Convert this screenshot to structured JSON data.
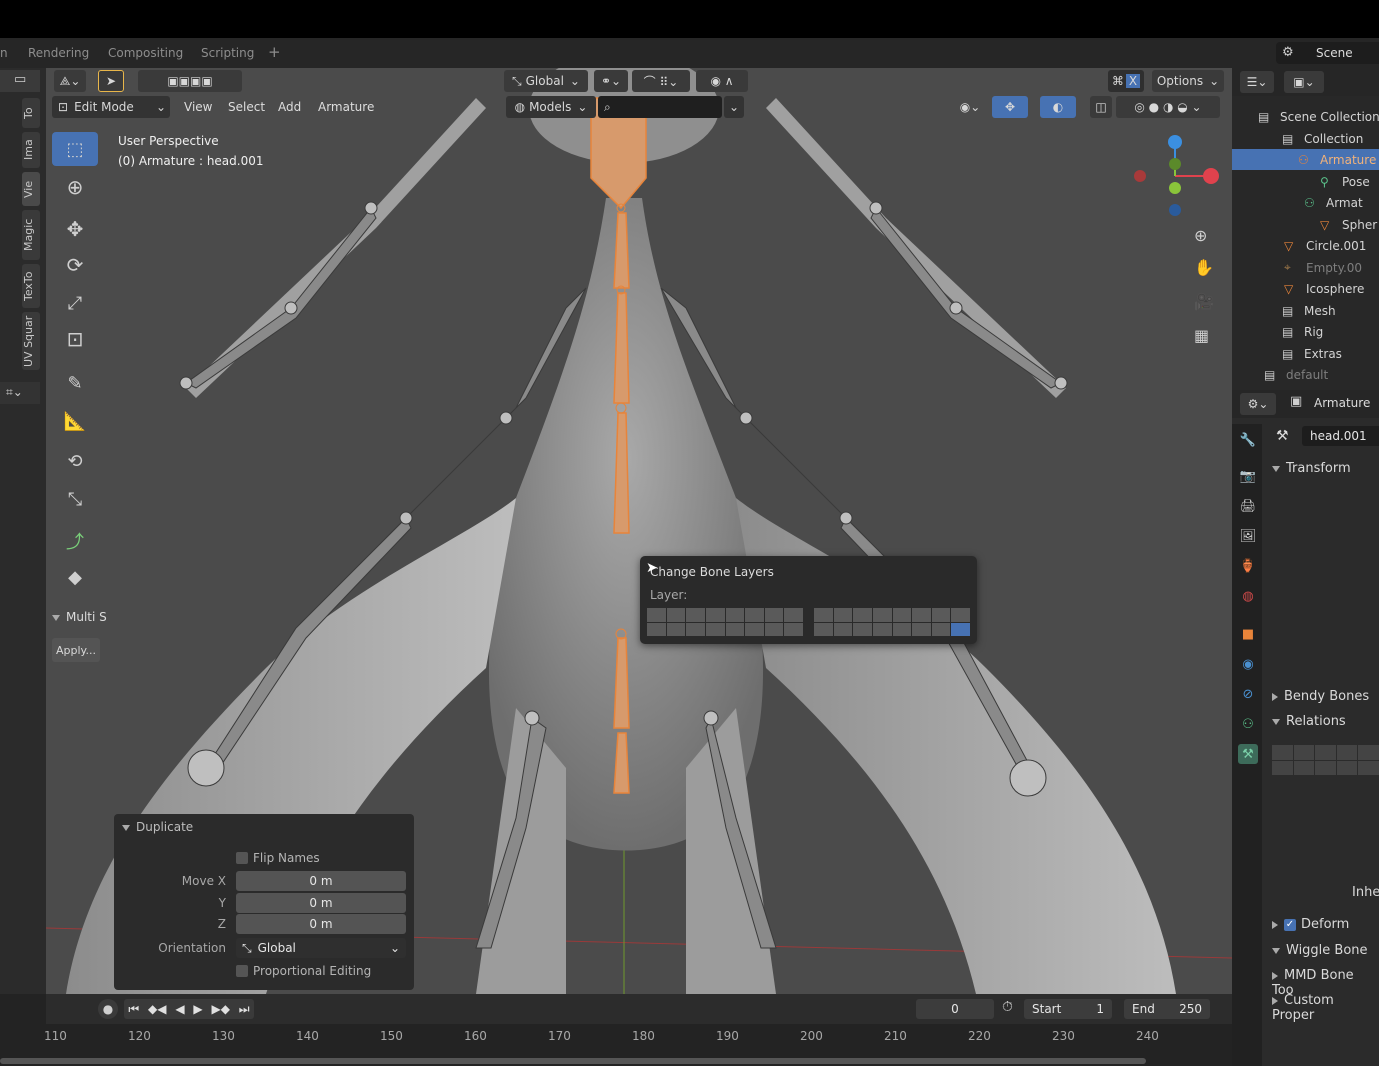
{
  "workspace_tabs": [
    "Rendering",
    "Compositing",
    "Scripting",
    "+"
  ],
  "scene": {
    "label": "Scene"
  },
  "viewport_header": {
    "transform_orientation": "Global",
    "options_label": "Options",
    "mode": "Edit Mode",
    "menus": [
      "View",
      "Select",
      "Add",
      "Armature"
    ],
    "collection_filter": "Models"
  },
  "left_tabs": [
    "To",
    "Ima",
    "Vie",
    "Magic",
    "TexTo",
    "UV Squar"
  ],
  "viewport_info": {
    "line1": "User Perspective",
    "line2": "(0) Armature : head.001"
  },
  "multi_panel": {
    "title": "Multi S",
    "apply_label": "Apply..."
  },
  "change_bone_layers": {
    "title": "Change Bone Layers",
    "layer_label": "Layer:",
    "active_layer_index": 31
  },
  "duplicate_panel": {
    "title": "Duplicate",
    "flip_names": "Flip Names",
    "move_x_label": "Move X",
    "y_label": "Y",
    "z_label": "Z",
    "move_x": "0 m",
    "move_y": "0 m",
    "move_z": "0 m",
    "orientation_label": "Orientation",
    "orientation": "Global",
    "proportional_editing": "Proportional Editing"
  },
  "timeline": {
    "current_frame": "0",
    "start_label": "Start",
    "start": "1",
    "end_label": "End",
    "end": "250",
    "ticks": [
      "110",
      "120",
      "130",
      "140",
      "150",
      "160",
      "170",
      "180",
      "190",
      "200",
      "210",
      "220",
      "230",
      "240"
    ]
  },
  "outliner": {
    "rows": [
      {
        "label": "Scene Collection",
        "type": "collection"
      },
      {
        "label": "Collection",
        "type": "collection"
      },
      {
        "label": "Armature",
        "type": "armature",
        "selected": true
      },
      {
        "label": "Pose",
        "type": "pose"
      },
      {
        "label": "Armat",
        "type": "armature-data"
      },
      {
        "label": "Spher",
        "type": "mesh"
      },
      {
        "label": "Circle.001",
        "type": "mesh"
      },
      {
        "label": "Empty.00",
        "type": "empty"
      },
      {
        "label": "Icosphere",
        "type": "mesh"
      },
      {
        "label": "Mesh",
        "type": "collection"
      },
      {
        "label": "Rig",
        "type": "collection"
      },
      {
        "label": "Extras",
        "type": "collection"
      },
      {
        "label": "default",
        "type": "collection"
      }
    ]
  },
  "properties": {
    "object_name": "Armature",
    "bone_name": "head.001",
    "sections": {
      "transform": "Transform",
      "bendy_bones": "Bendy Bones",
      "relations": "Relations",
      "inherit": "Inhe",
      "deform": "Deform",
      "wiggle_bone": "Wiggle Bone",
      "mmd_bone_tools": "MMD Bone Too",
      "custom_properties": "Custom Proper"
    }
  },
  "colors": {
    "accent_blue": "#4772b3",
    "selected_bone": "#e8843a",
    "axis_x": "#e0424d",
    "axis_y": "#8ac43a",
    "axis_z": "#3b8fe0"
  }
}
